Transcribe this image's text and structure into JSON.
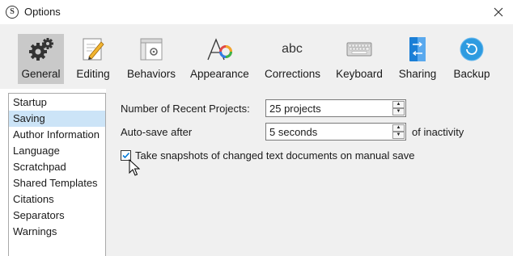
{
  "window": {
    "title": "Options",
    "app_icon": "S"
  },
  "toolbar": {
    "items": [
      {
        "label": "General",
        "icon": "gears-icon"
      },
      {
        "label": "Editing",
        "icon": "editing-icon"
      },
      {
        "label": "Behaviors",
        "icon": "behaviors-icon"
      },
      {
        "label": "Appearance",
        "icon": "appearance-icon"
      },
      {
        "label": "Corrections",
        "icon": "corrections-icon",
        "icon_text": "abc"
      },
      {
        "label": "Keyboard",
        "icon": "keyboard-icon"
      },
      {
        "label": "Sharing",
        "icon": "sharing-icon"
      },
      {
        "label": "Backup",
        "icon": "backup-icon"
      }
    ],
    "active": "General"
  },
  "sidebar": {
    "items": [
      {
        "label": "Startup"
      },
      {
        "label": "Saving"
      },
      {
        "label": "Author Information"
      },
      {
        "label": "Language"
      },
      {
        "label": "Scratchpad"
      },
      {
        "label": "Shared Templates"
      },
      {
        "label": "Citations"
      },
      {
        "label": "Separators"
      },
      {
        "label": "Warnings"
      }
    ],
    "selected": "Saving"
  },
  "settings": {
    "recent_projects": {
      "label": "Number of Recent Projects:",
      "value": "25 projects"
    },
    "autosave": {
      "label": "Auto-save after",
      "value": "5 seconds",
      "suffix": "of inactivity"
    },
    "snapshots": {
      "label": "Take snapshots of changed text documents on manual save",
      "checked": true
    }
  },
  "colors": {
    "toolbar_bg": "#f0f0f0",
    "active_tab_bg": "#c9c9c9",
    "selection_bg": "#cce4f7",
    "checkbox_accent": "#0078d7",
    "backup_icon": "#2e9be0",
    "sharing_icon": "#1b7fd6"
  }
}
